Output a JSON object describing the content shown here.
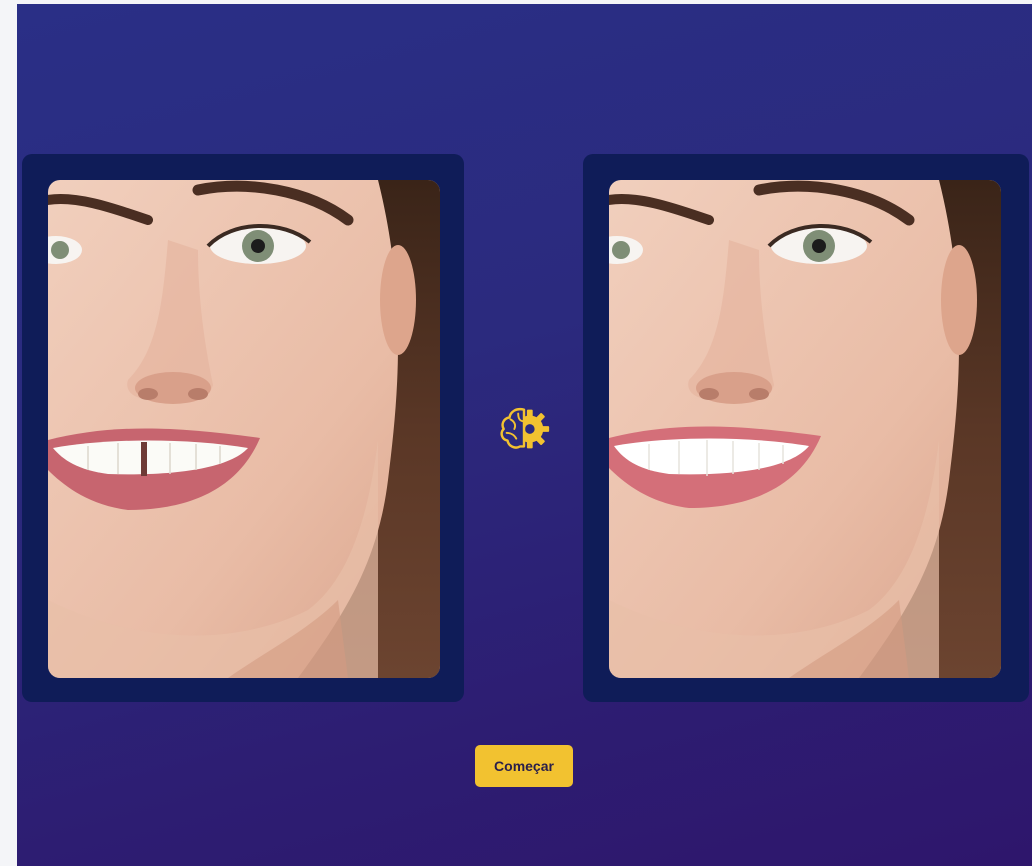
{
  "main": {
    "start_button_label": "Começar"
  },
  "icons": {
    "center": "brain-gear-icon"
  },
  "colors": {
    "background_top": "#2a2f86",
    "background_bottom": "#2e166c",
    "panel": "#0f1c58",
    "accent": "#f2c230",
    "button_text": "#2a1f4a"
  },
  "images": {
    "before": "face-before-photo",
    "after": "face-after-photo"
  }
}
